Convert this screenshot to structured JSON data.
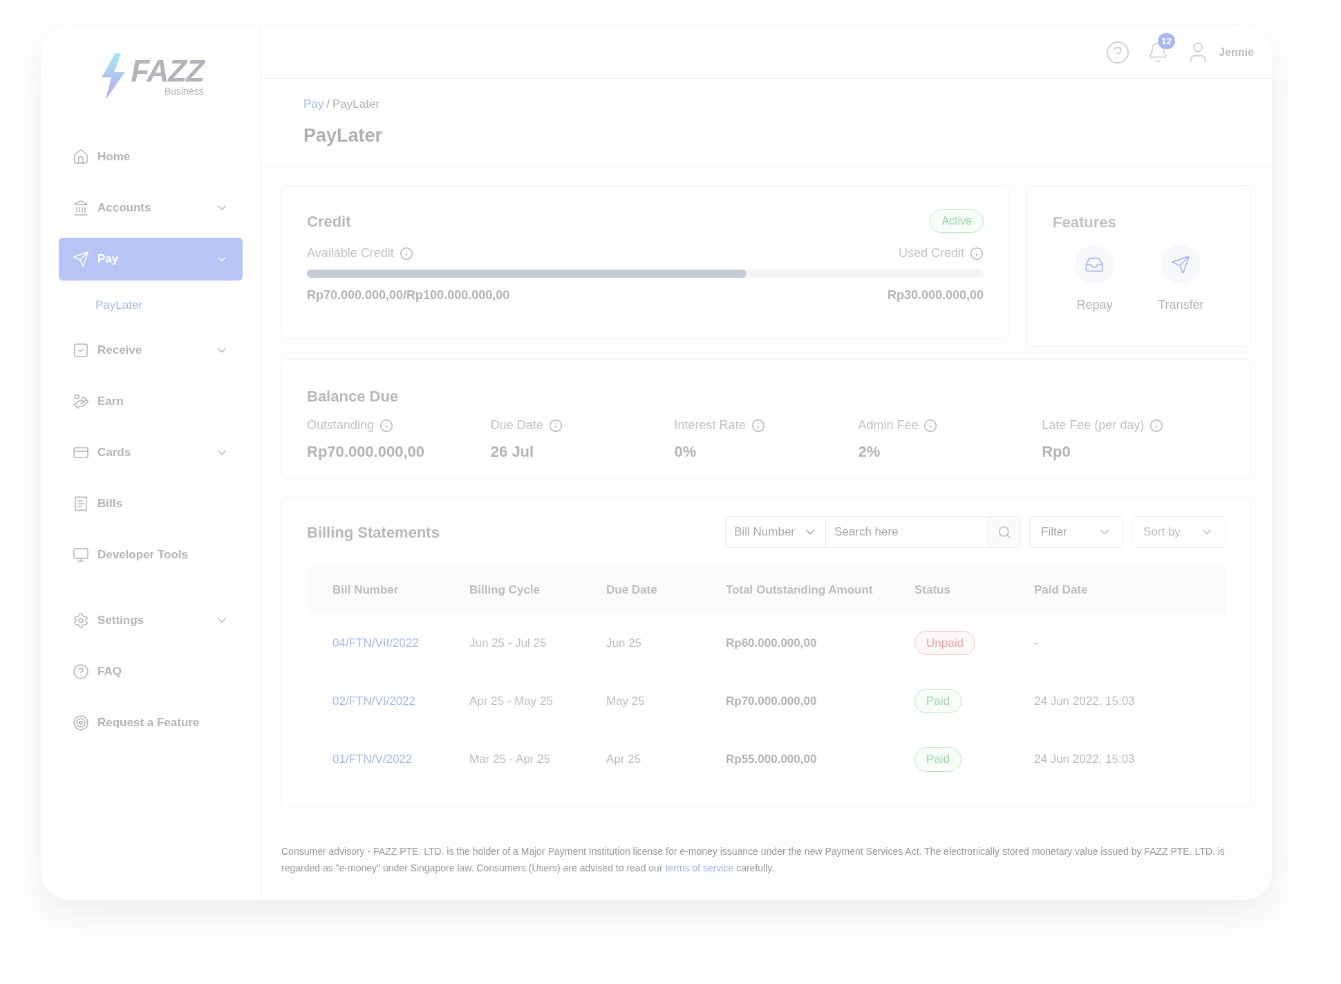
{
  "logo": {
    "wordmark": "FAZZ",
    "subtitle": "Business"
  },
  "sidebar": {
    "groups": [
      {
        "items": [
          {
            "label": "Home",
            "expandable": false,
            "selected": false
          },
          {
            "label": "Accounts",
            "expandable": true,
            "selected": false
          },
          {
            "label": "Pay",
            "expandable": true,
            "selected": true,
            "children": [
              {
                "label": "PayLater",
                "selected": true
              }
            ]
          },
          {
            "label": "Receive",
            "expandable": true,
            "selected": false
          },
          {
            "label": "Earn",
            "expandable": false,
            "selected": false
          },
          {
            "label": "Cards",
            "expandable": true,
            "selected": false
          },
          {
            "label": "Bills",
            "expandable": false,
            "selected": false
          },
          {
            "label": "Developer Tools",
            "expandable": false,
            "selected": false
          }
        ]
      },
      {
        "items": [
          {
            "label": "Settings",
            "expandable": true,
            "selected": false
          },
          {
            "label": "FAQ",
            "expandable": false,
            "selected": false
          },
          {
            "label": "Request a Feature",
            "expandable": false,
            "selected": false
          }
        ]
      }
    ]
  },
  "topbar": {
    "notification_count": "12",
    "user": "Jennie"
  },
  "breadcrumb": {
    "separator": "/",
    "items": [
      "Pay",
      "PayLater"
    ]
  },
  "title": "PayLater",
  "credit": {
    "title": "Credit",
    "status": "Active",
    "available_label": "Available Credit",
    "used_label": "Used Credit",
    "level": 0.65,
    "available_value": "Rp70.000.000,00/Rp100.000.000,00",
    "used_value": "Rp30.000.000,00"
  },
  "features": {
    "title": "Features",
    "items": [
      {
        "label": "Repay"
      },
      {
        "label": "Transfer"
      }
    ]
  },
  "balance_due": {
    "title": "Balance Due",
    "items": [
      {
        "label": "Outstanding",
        "value": "Rp70.000.000,00"
      },
      {
        "label": "Due Date",
        "value": "26 Jul"
      },
      {
        "label": "Interest Rate",
        "value": "0%"
      },
      {
        "label": "Admin Fee",
        "value": "2%"
      },
      {
        "label": "Late Fee (per day)",
        "value": "Rp0"
      }
    ]
  },
  "billing": {
    "title": "Billing Statements",
    "search_by": "Bill Number",
    "placeholder": "Search here",
    "filter": "Filter",
    "sort": "Sort by",
    "columns": [
      "Bill Number",
      "Billing Cycle",
      "Due Date",
      "Total Outstanding Amount",
      "Status",
      "Paid Date"
    ],
    "rows": [
      {
        "bill_number": "04/FTN/VII/2022",
        "cycle": "Jun 25 - Jul 25",
        "due": "Jun 25",
        "amount": "Rp60.000.000,00",
        "status": "Unpaid",
        "kind": "unpaid",
        "paid_date": "-"
      },
      {
        "bill_number": "02/FTN/VI/2022",
        "cycle": "Apr 25 - May 25",
        "due": "May 25",
        "amount": "Rp70.000.000,00",
        "status": "Paid",
        "kind": "paid",
        "paid_date": "24 Jun 2022, 15:03"
      },
      {
        "bill_number": "01/FTN/V/2022",
        "cycle": "Mar 25 - Apr 25",
        "due": "Apr 25",
        "amount": "Rp55.000.000,00",
        "status": "Paid",
        "kind": "paid",
        "paid_date": "24 Jun 2022, 15:03"
      }
    ]
  },
  "footer": {
    "text_before": "Consumer advisory - FAZZ PTE. LTD. is the holder of a Major Payment Institution license for e-money issuance under the new Payment Services Act. The electronically stored monetary value issued by FAZZ PTE. LTD. is regarded as \"e-money\" under Singapore law. Consumers (Users) are advised to read our",
    "link": "terms of service",
    "text_after": "carefully."
  }
}
